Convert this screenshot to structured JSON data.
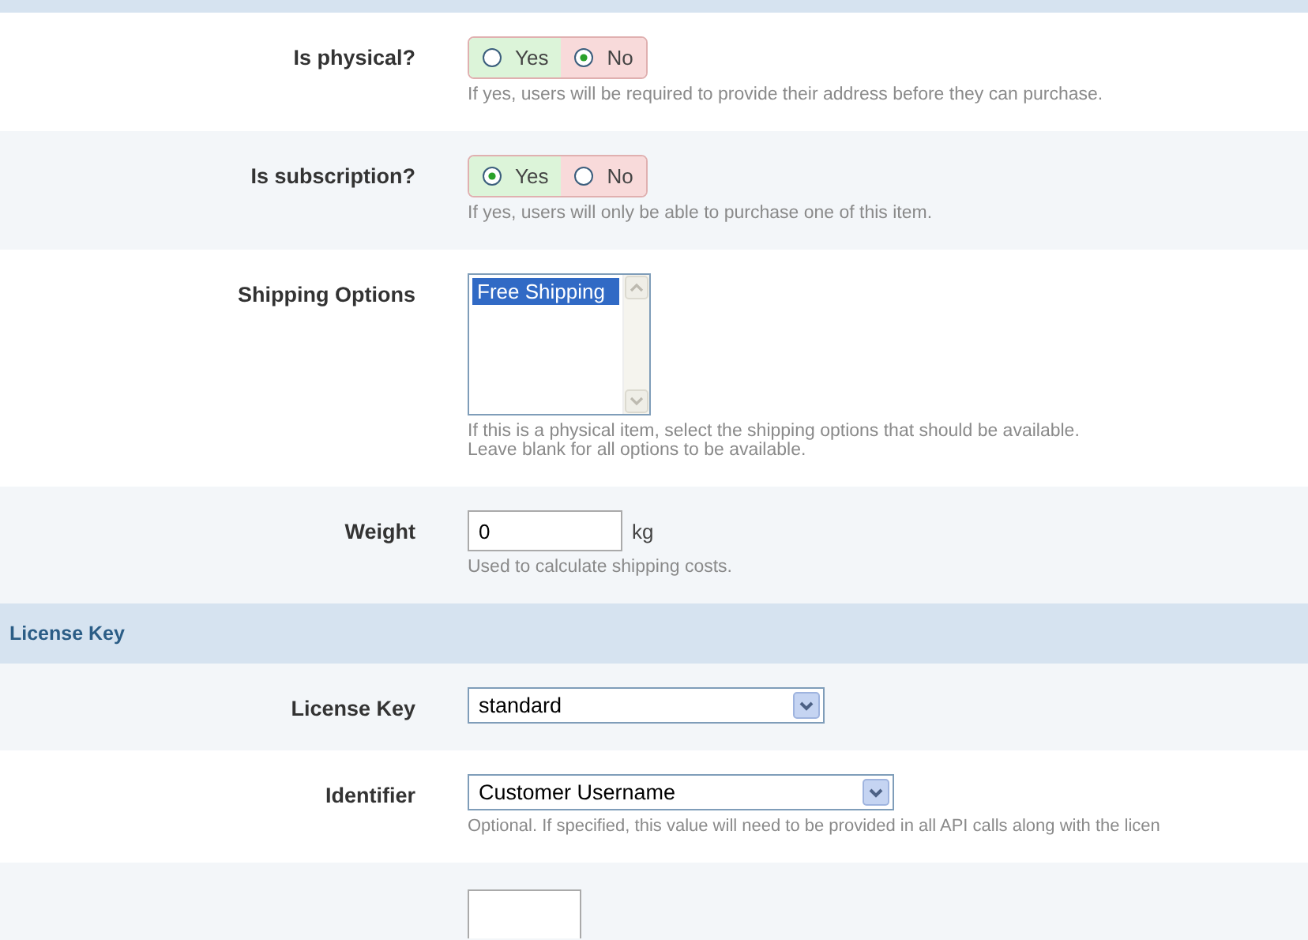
{
  "rows": [
    {
      "kind": "yesno",
      "label": "Is physical?",
      "options": [
        {
          "label": "Yes",
          "selected": false
        },
        {
          "label": "No",
          "selected": true
        }
      ],
      "hint": "If yes, users will be required to provide their address before they can purchase."
    },
    {
      "kind": "yesno",
      "label": "Is subscription?",
      "options": [
        {
          "label": "Yes",
          "selected": true
        },
        {
          "label": "No",
          "selected": false
        }
      ],
      "hint": "If yes, users will only be able to purchase one of this item."
    },
    {
      "kind": "listbox",
      "label": "Shipping Options",
      "items": [
        {
          "label": "Free Shipping",
          "selected": true
        }
      ],
      "hint": "If this is a physical item, select the shipping options that should be available.\nLeave blank for all options to be available."
    },
    {
      "kind": "number",
      "label": "Weight",
      "value": "0",
      "unit": "kg",
      "hint": "Used to calculate shipping costs."
    },
    {
      "kind": "section",
      "label": "License Key"
    },
    {
      "kind": "select",
      "label": "License Key",
      "value": "standard"
    },
    {
      "kind": "select",
      "label": "Identifier",
      "value": "Customer Username",
      "hint": "Optional. If specified, this value will need to be provided in all API calls along with the licen"
    },
    {
      "kind": "partial"
    }
  ]
}
